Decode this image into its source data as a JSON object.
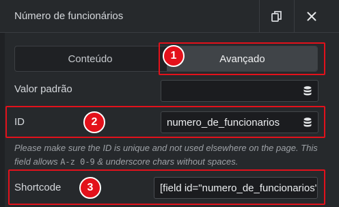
{
  "header": {
    "title": "Número de funcionários",
    "copy_icon": "copy-icon",
    "close_icon": "close-icon"
  },
  "tabs": [
    {
      "label": "Conteúdo",
      "active": false
    },
    {
      "label": "Avançado",
      "active": true
    }
  ],
  "fields": {
    "default_value": {
      "label": "Valor padrão",
      "value": "",
      "icon": "database-icon"
    },
    "id": {
      "label": "ID",
      "value": "numero_de_funcionarios",
      "icon": "database-icon"
    },
    "help_prefix": "Please make sure the ID is unique and not used elsewhere on the page. This field allows ",
    "help_chars": "A-z 0-9",
    "help_suffix": " & underscore chars without spaces.",
    "shortcode": {
      "label": "Shortcode",
      "value": "[field id=\"numero_de_funcionarios\"]"
    }
  },
  "annotations": [
    "1",
    "2",
    "3"
  ],
  "colors": {
    "annotation": "#e3111b",
    "background": "#26292c",
    "input": "#1b1c1f"
  }
}
